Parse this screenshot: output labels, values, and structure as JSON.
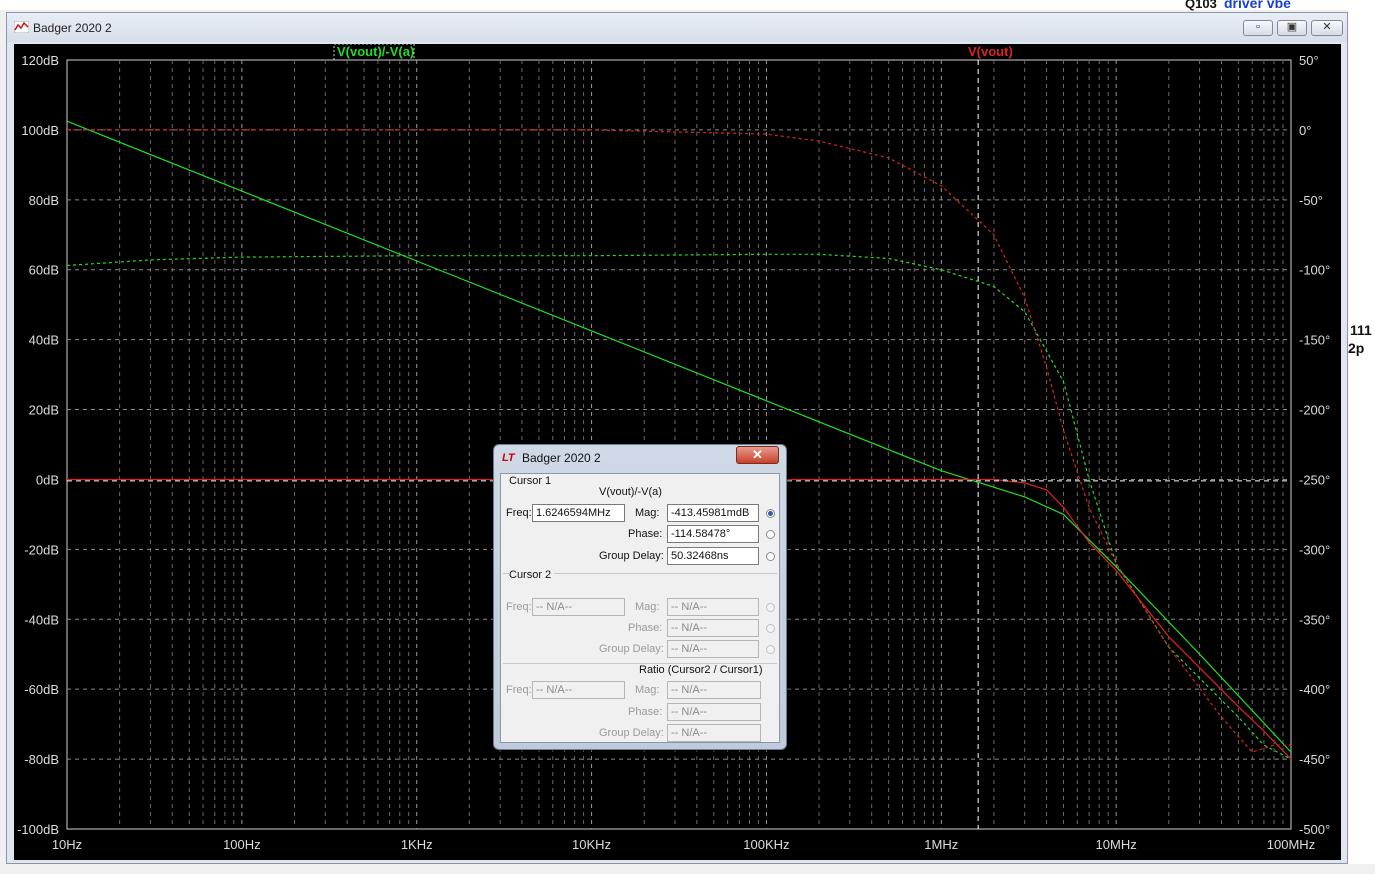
{
  "window": {
    "title": "Badger 2020 2"
  },
  "background": {
    "label_top": "Q103",
    "label_top_blue": "driver vbe",
    "label_right_1": "111",
    "label_right_2": "2p"
  },
  "chart_data": {
    "type": "line",
    "x_axis": {
      "scale": "log",
      "range": [
        "10Hz",
        "100MHz"
      ],
      "tick_labels": [
        "10Hz",
        "100Hz",
        "1KHz",
        "10KHz",
        "100KHz",
        "1MHz",
        "10MHz",
        "100MHz"
      ]
    },
    "y_left": {
      "range": [
        -100,
        120
      ],
      "unit": "dB",
      "tick_labels": [
        "120dB",
        "100dB",
        "80dB",
        "60dB",
        "40dB",
        "20dB",
        "0dB",
        "-20dB",
        "-40dB",
        "-60dB",
        "-80dB",
        "-100dB"
      ]
    },
    "y_right": {
      "range": [
        -500,
        50
      ],
      "unit": "°",
      "tick_labels": [
        "50°",
        "0°",
        "-50°",
        "-100°",
        "-150°",
        "-200°",
        "-250°",
        "-300°",
        "-350°",
        "-400°",
        "-450°",
        "-500°"
      ]
    },
    "grid": true,
    "series": [
      {
        "name": "V(vout)/-V(a)",
        "color": "#22dd22",
        "kind": "magnitude",
        "points": [
          [
            10,
            102.5
          ],
          [
            100,
            82.5
          ],
          [
            1000,
            62.5
          ],
          [
            10000,
            42.5
          ],
          [
            100000,
            22.5
          ],
          [
            1000000,
            2.5
          ],
          [
            3000000,
            -5
          ],
          [
            5000000,
            -10
          ],
          [
            10000000,
            -25
          ],
          [
            30000000,
            -50
          ],
          [
            100000000,
            -78
          ]
        ]
      },
      {
        "name": "V(vout)/-V(a)",
        "color": "#22dd22",
        "kind": "phase",
        "points": [
          [
            10,
            -97
          ],
          [
            30,
            -93
          ],
          [
            100,
            -91
          ],
          [
            1000,
            -90
          ],
          [
            10000,
            -90
          ],
          [
            100000,
            -89
          ],
          [
            200000,
            -89
          ],
          [
            500000,
            -92
          ],
          [
            1000000,
            -100
          ],
          [
            2000000,
            -112
          ],
          [
            3000000,
            -130
          ],
          [
            5000000,
            -180
          ],
          [
            7000000,
            -250
          ],
          [
            10000000,
            -310
          ],
          [
            20000000,
            -370
          ],
          [
            50000000,
            -420
          ],
          [
            70000000,
            -440
          ],
          [
            100000000,
            -450
          ]
        ]
      },
      {
        "name": "V(vout)",
        "color": "#dd2222",
        "kind": "magnitude",
        "points": [
          [
            10,
            0
          ],
          [
            1000,
            0
          ],
          [
            100000,
            0
          ],
          [
            1000000,
            0
          ],
          [
            2000000,
            0
          ],
          [
            3000000,
            -1
          ],
          [
            4000000,
            -3
          ],
          [
            5000000,
            -8
          ],
          [
            7000000,
            -18
          ],
          [
            10000000,
            -26
          ],
          [
            20000000,
            -45
          ],
          [
            50000000,
            -65
          ],
          [
            70000000,
            -72
          ],
          [
            100000000,
            -80
          ]
        ]
      },
      {
        "name": "V(vout)",
        "color": "#dd2222",
        "kind": "phase",
        "points": [
          [
            10,
            0
          ],
          [
            1000,
            0
          ],
          [
            10000,
            0
          ],
          [
            100000,
            -3
          ],
          [
            200000,
            -8
          ],
          [
            500000,
            -20
          ],
          [
            1000000,
            -40
          ],
          [
            2000000,
            -75
          ],
          [
            3000000,
            -120
          ],
          [
            4000000,
            -170
          ],
          [
            5000000,
            -215
          ],
          [
            7000000,
            -270
          ],
          [
            10000000,
            -310
          ],
          [
            20000000,
            -370
          ],
          [
            40000000,
            -420
          ],
          [
            60000000,
            -445
          ],
          [
            80000000,
            -440
          ],
          [
            100000000,
            -440
          ]
        ]
      }
    ],
    "legend": {
      "left_label": "V(vout)/-V(a)",
      "right_label": "V(vout)"
    },
    "cursor": {
      "freq_hz": 1624659.4,
      "mag_db": -0.413
    }
  },
  "dialog": {
    "title": "Badger 2020 2",
    "close_glyph": "✕",
    "cursor1": {
      "header": "Cursor 1",
      "trace": "V(vout)/-V(a)",
      "freq_label": "Freq:",
      "freq_value": "1.6246594MHz",
      "mag_label": "Mag:",
      "mag_value": "-413.45981mdB",
      "phase_label": "Phase:",
      "phase_value": "-114.58478°",
      "gd_label": "Group Delay:",
      "gd_value": "50.32468ns"
    },
    "cursor2": {
      "header": "Cursor 2",
      "freq_label": "Freq:",
      "freq_value": "-- N/A--",
      "mag_label": "Mag:",
      "mag_value": "-- N/A--",
      "phase_label": "Phase:",
      "phase_value": "-- N/A--",
      "gd_label": "Group Delay:",
      "gd_value": "-- N/A--"
    },
    "ratio": {
      "header": "Ratio (Cursor2 / Cursor1)",
      "freq_label": "Freq:",
      "freq_value": "-- N/A--",
      "mag_label": "Mag:",
      "mag_value": "-- N/A--",
      "phase_label": "Phase:",
      "phase_value": "-- N/A--",
      "gd_label": "Group Delay:",
      "gd_value": "-- N/A--"
    }
  }
}
